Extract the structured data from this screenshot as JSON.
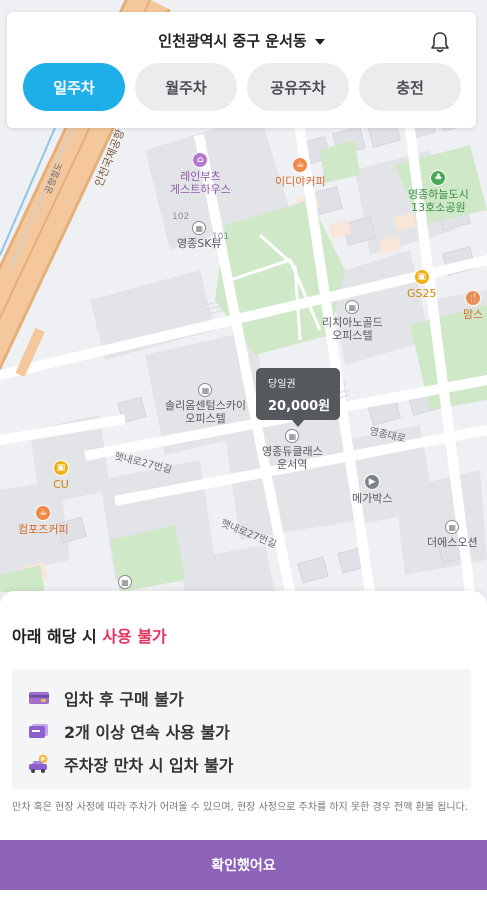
{
  "header": {
    "location": "인천광역시 중구 운서동",
    "tabs": [
      {
        "label": "일주차",
        "active": true
      },
      {
        "label": "월주차",
        "active": false
      },
      {
        "label": "공유주차",
        "active": false
      },
      {
        "label": "충전",
        "active": false
      }
    ]
  },
  "map": {
    "price_tooltip": {
      "title": "당일권",
      "price": "20,000원"
    },
    "pois": {
      "reinbooth": "레인부츠\n게스트하우스",
      "idiya": "이디야커피",
      "yeongjong_park": "영종하늘도시\n13호소공원",
      "gs25": "GS25",
      "moms": "맘스",
      "yeongjong_sk": "영종SK뷰",
      "richiano": "리치아노골드\n오피스텔",
      "soliom": "솔리옴센텀스카이\n오피스텔",
      "dubleclass": "영종듀클래스\n운서역",
      "megabox": "메가박스",
      "cu_left": "CU",
      "cu_top": "CU",
      "compose": "컴포즈커피",
      "theesoseon": "더에스오션"
    },
    "numbers": {
      "n102": "102",
      "n101": "101"
    },
    "roads": {
      "incheon_expressway": "인천국제공항",
      "gonghang_ro": "공항철도",
      "yeongjong_daero": "영종대로",
      "haenaero27_a": "햇내로27번길",
      "haenaero27_b": "햇내로27번길"
    }
  },
  "sheet": {
    "title_prefix": "아래 해당 시 ",
    "title_highlight": "사용 불가",
    "rules": [
      {
        "icon": "card-icon",
        "text": "입차 후 구매 불가"
      },
      {
        "icon": "ticket-icon",
        "text": "2개 이상 연속 사용 불가"
      },
      {
        "icon": "full-parking-car-icon",
        "text": "주차장 만차 시 입차 불가"
      }
    ],
    "note": "만차 혹은 현장 사정에 따라 주차가 어려울 수 있으며, 현장 사정으로 주차를 하지 못한 경우 전액 환불 됩니다.",
    "confirm_label": "확인했어요"
  },
  "colors": {
    "accent_blue": "#1eaee8",
    "highlight_red": "#e8335e",
    "confirm_purple": "#8c63b9"
  }
}
